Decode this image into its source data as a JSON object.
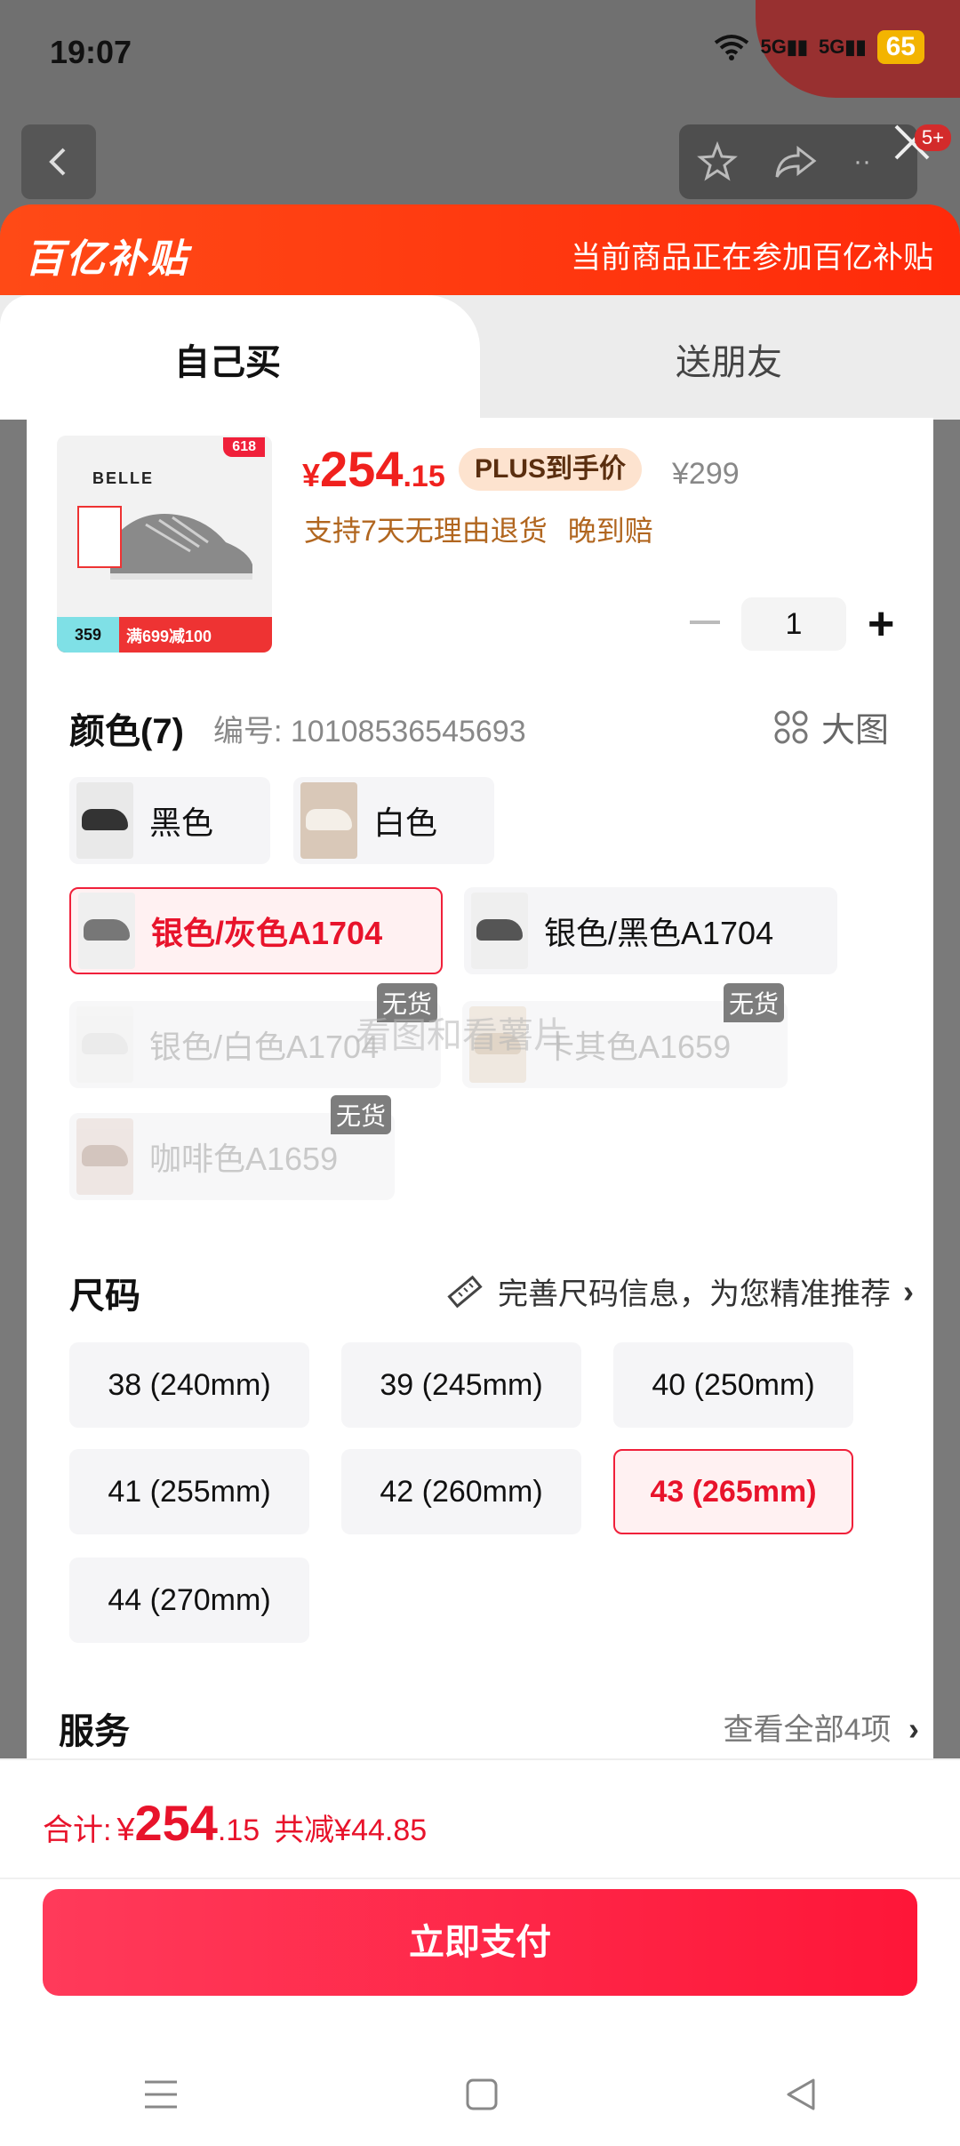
{
  "status_bar": {
    "time": "19:07",
    "network1": "5G",
    "network2": "5G",
    "battery": "65"
  },
  "background": {
    "badge": "5+"
  },
  "banner": {
    "logo": "百亿补贴",
    "message": "当前商品正在参加百亿补贴"
  },
  "tabs": {
    "self": "自己买",
    "gift": "送朋友"
  },
  "product": {
    "brand": "BELLE",
    "price_symbol": "¥",
    "price_int": "254",
    "price_dec": ".15",
    "plus_badge": "PLUS到手价",
    "original_price": "¥299",
    "promo_return": "支持7天无理由退货",
    "promo_late": "晚到赔",
    "quantity": "1",
    "thumb_tag": "618",
    "thumb_price": "359",
    "thumb_deal": "满699减100"
  },
  "color": {
    "title": "颜色(7)",
    "sku": "编号: 10108536545693",
    "big_pic": "大图",
    "options": [
      {
        "label": "黑色"
      },
      {
        "label": "白色"
      },
      {
        "label": "银色/灰色A1704"
      },
      {
        "label": "银色/黑色A1704"
      },
      {
        "label": "银色/白色A1704"
      },
      {
        "label": "卡其色A1659"
      },
      {
        "label": "咖啡色A1659"
      }
    ],
    "no_stock": "无货",
    "watermark": "看图和看薯片"
  },
  "size": {
    "title": "尺码",
    "tip": "完善尺码信息，为您精准推荐",
    "options": [
      "38 (240mm)",
      "39 (245mm)",
      "40 (250mm)",
      "41 (255mm)",
      "42 (260mm)",
      "43 (265mm)",
      "44 (270mm)"
    ]
  },
  "service": {
    "title": "服务",
    "link": "查看全部4项"
  },
  "bottom": {
    "total_label": "合计:",
    "total_symbol": "¥",
    "total_int": "254",
    "total_dec": ".15",
    "saved": "共减¥44.85",
    "pay_button": "立即支付"
  },
  "colors": {
    "accent": "#f0211e",
    "banner": "#ff3a10",
    "pay_button": "#fe1638",
    "gold": "#b1661f"
  }
}
